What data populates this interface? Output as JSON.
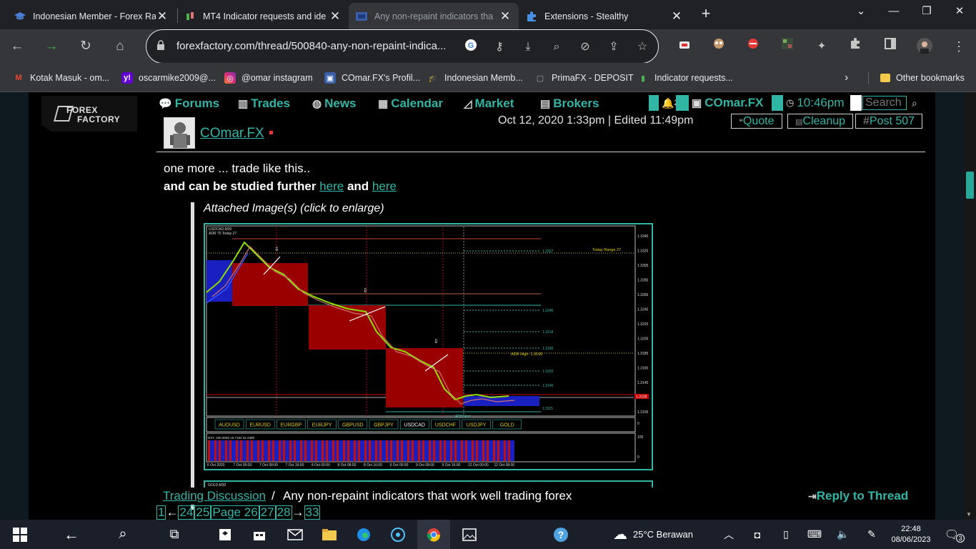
{
  "tabs": [
    {
      "title": "Indonesian Member - Forex Ra",
      "icon": "graduation-cap-icon"
    },
    {
      "title": "MT4 Indicator requests and ide",
      "icon": "candles-icon"
    },
    {
      "title": "Any non-repaint indicators tha",
      "icon": "forex-factory-icon"
    },
    {
      "title": "Extensions - Stealthy",
      "icon": "puzzle-icon"
    }
  ],
  "address": {
    "url": "forexfactory.com/thread/500840-any-non-repaint-indica..."
  },
  "bookmarks": [
    {
      "label": "Kotak Masuk - om..."
    },
    {
      "label": "oscarmike2009@..."
    },
    {
      "label": "@omar instagram"
    },
    {
      "label": "COmar.FX's Profil..."
    },
    {
      "label": "Indonesian Memb..."
    },
    {
      "label": "PrimaFX - DEPOSIT"
    },
    {
      "label": "Indicator requests..."
    }
  ],
  "other_bookmarks": "Other bookmarks",
  "site": {
    "logo_line1": "FOREX",
    "logo_line2": "FACTORY",
    "nav": [
      "Forums",
      "Trades",
      "News",
      "Calendar",
      "Market",
      "Brokers"
    ],
    "notif_count": "2",
    "username": "COmar.FX",
    "time": "10:46pm",
    "search_placeholder": "Search"
  },
  "post": {
    "author": "COmar.FX",
    "date": "Oct 12, 2020 1:33pm",
    "sep": "|",
    "edited": "Edited 11:49pm",
    "quote_btn": "Quote",
    "cleanup_btn": "Cleanup",
    "post_num": "Post 507",
    "line1": "one more ... trade like this..",
    "line2_text": "and can be studied further ",
    "link1": "here",
    "and": " and ",
    "link2": "here",
    "attached_label": "Attached Image(s) (click to enlarge)"
  },
  "chart": {
    "symbol": "USDCAD,M30",
    "adr": "ADR 75  Today 27",
    "today_range": "Today Range   27",
    "adr_high": "ADR High: 1.3190",
    "adr_start": "ADRStart",
    "price_ticks": [
      "1.3345",
      "1.3325",
      "1.3305",
      "1.3285",
      "1.3265",
      "1.3245",
      "1.3225",
      "1.3205",
      "1.3185",
      "1.3165",
      "1.3145",
      "1.3125",
      "1.3105"
    ],
    "level_labels": [
      "1.3327",
      "1.3246",
      "1.3218",
      "1.3196",
      "1.3165",
      "1.3146",
      "1.3115"
    ],
    "current_price": "1.3128",
    "pairs": [
      "AUDUSD",
      "EURUSD",
      "EURGBP",
      "EURJPY",
      "GBPUSD",
      "GBPJPY",
      "USDCAD",
      "USDCHF",
      "USDJPY",
      "GOLD"
    ],
    "dxy": "DXY, 100.0000 15.7193 32.2389",
    "dates": [
      "6 Oct 2020",
      "7 Oct 00:00",
      "7 Oct 08:00",
      "7 Oct 16:00",
      "8 Oct 00:00",
      "8 Oct 08:00",
      "8 Oct 16:00",
      "9 Oct 00:00",
      "9 Oct 08:00",
      "9 Oct 16:00",
      "12 Oct 00:00",
      "12 Oct 08:00"
    ],
    "sub_ticks": [
      "0",
      "105",
      "0"
    ],
    "chart2_label": "GOLD,M30"
  },
  "thread": {
    "crumb": "Trading Discussion",
    "slash": "/",
    "title": "Any non-repaint indicators that work well trading forex",
    "reply": "Reply to Thread"
  },
  "pager": {
    "first": "1",
    "arrow_l": "←",
    "pages": [
      "24",
      "25"
    ],
    "current": "Page 26",
    "pages_after": [
      "27",
      "28"
    ],
    "arrow_r": "→",
    "last": "33"
  },
  "taskbar": {
    "weather": "25°C  Berawan",
    "time": "22:48",
    "date": "08/06/2023",
    "notif": "3"
  }
}
